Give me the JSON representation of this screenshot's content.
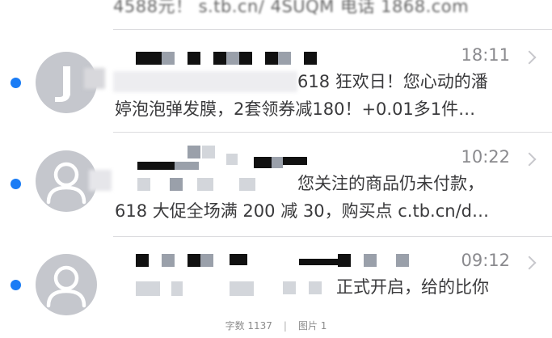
{
  "top_snippet": "4588元！ s.tb.cn/ 4SUQM 电话 1868.com",
  "messages": [
    {
      "time": "18:11",
      "preview_line1": "618 狂欢日！您心动的潘",
      "preview_line2": "婷泡泡弹发膜，2套领券减180！+0.01多1件…",
      "unread": true,
      "avatar": "letter-avatar-icon"
    },
    {
      "time": "10:22",
      "preview_line1": "您关注的商品仍未付款，",
      "preview_line2": "618 大促全场满 200 减 30，购买点 c.tb.cn/d…",
      "unread": true,
      "avatar": "person-avatar-icon"
    },
    {
      "time": "09:12",
      "preview_line1": "正式开启，给的比你",
      "preview_line2": "",
      "unread": true,
      "avatar": "person-avatar-icon"
    }
  ],
  "footer": {
    "word_count": "字数 1137",
    "divider": "|",
    "image_label": "图片 1"
  },
  "colors": {
    "unread_dot": "#1a7cf5",
    "time_text": "#8a8a8e",
    "avatar_bg": "#c5c7cd"
  }
}
